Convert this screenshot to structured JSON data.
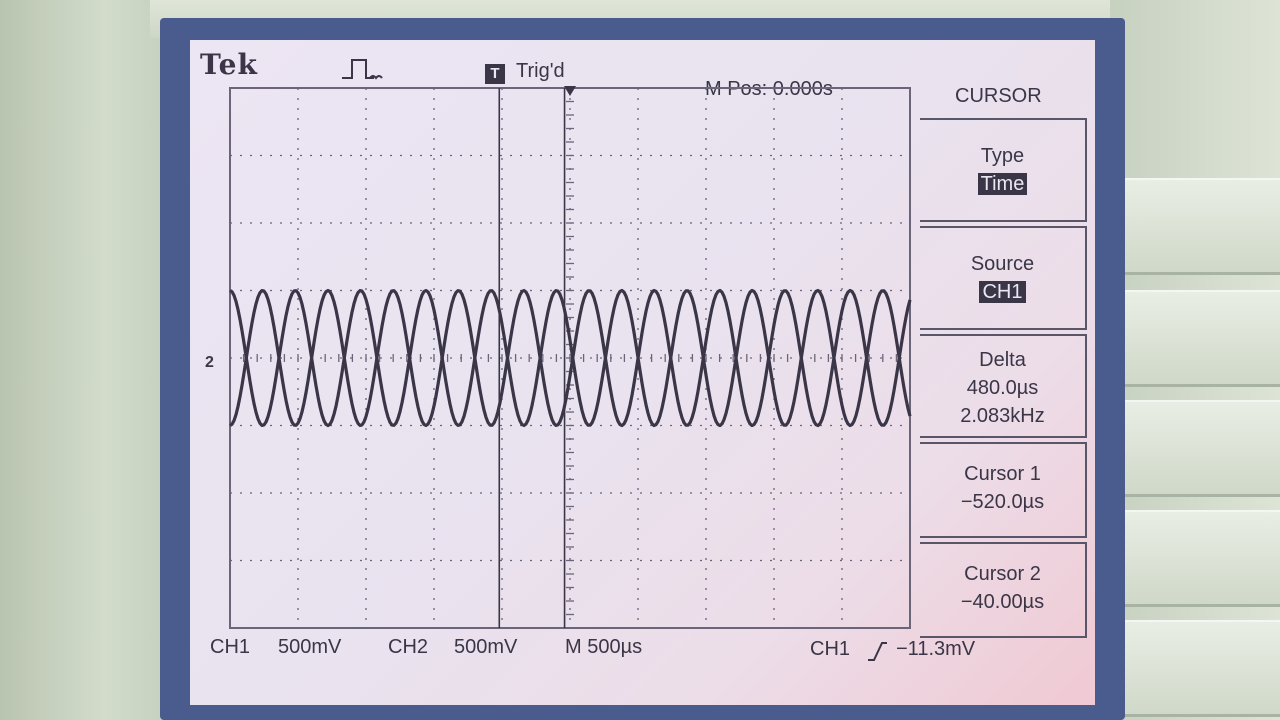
{
  "header": {
    "brand": "Tek",
    "acquire_icon": "run-pulse-icon",
    "trigger_marker": "T",
    "trigger_status": "Trig'd",
    "main_position": "M Pos: 0.000s",
    "menu_title": "CURSOR"
  },
  "menu": [
    {
      "label": "Type",
      "value": "Time",
      "selected": true
    },
    {
      "label": "Source",
      "value": "CH1",
      "selected": true
    },
    {
      "label": "Delta",
      "lines": [
        "480.0µs",
        "2.083kHz"
      ]
    },
    {
      "label": "Cursor 1",
      "lines": [
        "−520.0µs"
      ]
    },
    {
      "label": "Cursor 2",
      "lines": [
        "−40.00µs"
      ]
    }
  ],
  "status": {
    "ch1_label": "CH1",
    "ch1_scale": "500mV",
    "ch2_label": "CH2",
    "ch2_scale": "500mV",
    "timebase": "M 500µs",
    "trigger_source": "CH1",
    "trigger_slope_icon": "rising-edge-icon",
    "trigger_level": "−11.3mV"
  },
  "ground_marker": "2",
  "chart_data": {
    "type": "line",
    "x_unit": "µs",
    "x_per_div": 500,
    "y_per_div_mV": 500,
    "divisions_x": 10,
    "divisions_y": 8,
    "grid": true,
    "series": [
      {
        "name": "CH1",
        "frequency_kHz": 2.083,
        "amplitude_div": 1.0,
        "phase_deg": 0
      },
      {
        "name": "CH2",
        "frequency_kHz": 2.083,
        "amplitude_div": 1.0,
        "phase_deg": 180
      }
    ],
    "cursors_us": [
      -520.0,
      -40.0
    ],
    "colors": {
      "trace": "#3a3647",
      "grid": "#6a6578"
    }
  }
}
